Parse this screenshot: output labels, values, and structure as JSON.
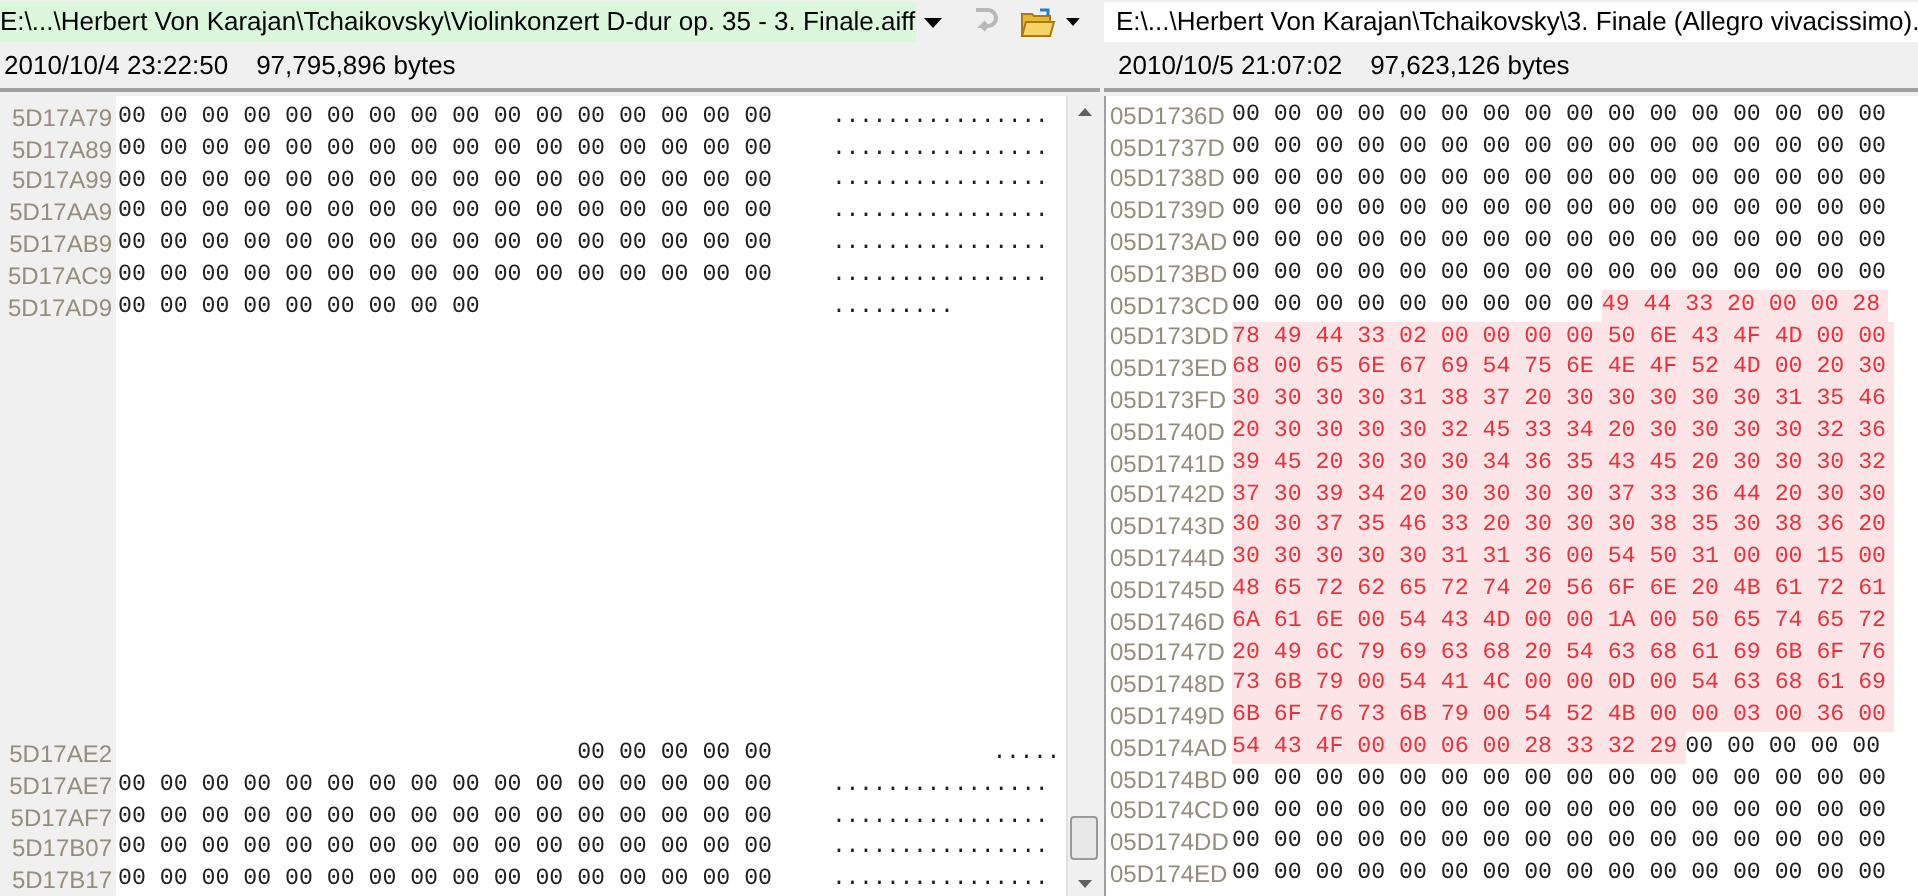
{
  "left": {
    "path": "E:\\...\\Herbert Von Karajan\\Tchaikovsky\\Violinkonzert D-dur op. 35 - 3. Finale.aiff",
    "modified": "2010/10/4 23:22:50",
    "size": "97,795,896 bytes",
    "blocks": [
      {
        "rows": [
          {
            "address": "5D17A79",
            "kind": "full",
            "segments": [
              {
                "text": "00 00 00 00 00 00 00 00 00 00 00 00 00 00 00 00",
                "changed": false
              }
            ],
            "ascii": "................"
          },
          {
            "address": "5D17A89",
            "kind": "full",
            "segments": [
              {
                "text": "00 00 00 00 00 00 00 00 00 00 00 00 00 00 00 00",
                "changed": false
              }
            ],
            "ascii": "................"
          },
          {
            "address": "5D17A99",
            "kind": "full",
            "segments": [
              {
                "text": "00 00 00 00 00 00 00 00 00 00 00 00 00 00 00 00",
                "changed": false
              }
            ],
            "ascii": "................"
          },
          {
            "address": "5D17AA9",
            "kind": "full",
            "segments": [
              {
                "text": "00 00 00 00 00 00 00 00 00 00 00 00 00 00 00 00",
                "changed": false
              }
            ],
            "ascii": "................"
          },
          {
            "address": "5D17AB9",
            "kind": "full",
            "segments": [
              {
                "text": "00 00 00 00 00 00 00 00 00 00 00 00 00 00 00 00",
                "changed": false
              }
            ],
            "ascii": "................"
          },
          {
            "address": "5D17AC9",
            "kind": "full",
            "segments": [
              {
                "text": "00 00 00 00 00 00 00 00 00 00 00 00 00 00 00 00",
                "changed": false
              }
            ],
            "ascii": "................"
          },
          {
            "address": "5D17AD9",
            "kind": "full",
            "segments": [
              {
                "text": "00 00 00 00 00 00 00 00 00",
                "changed": false
              }
            ],
            "ascii": "........."
          }
        ]
      },
      {
        "rows": [
          {
            "address": "5D17AE2",
            "kind": "tail",
            "segments": [
              {
                "text": "00 00 00 00 00",
                "changed": false
              }
            ],
            "ascii": "....."
          },
          {
            "address": "5D17AE7",
            "kind": "full",
            "segments": [
              {
                "text": "00 00 00 00 00 00 00 00 00 00 00 00 00 00 00 00",
                "changed": false
              }
            ],
            "ascii": "................"
          },
          {
            "address": "5D17AF7",
            "kind": "full",
            "segments": [
              {
                "text": "00 00 00 00 00 00 00 00 00 00 00 00 00 00 00 00",
                "changed": false
              }
            ],
            "ascii": "................"
          },
          {
            "address": "5D17B07",
            "kind": "full",
            "segments": [
              {
                "text": "00 00 00 00 00 00 00 00 00 00 00 00 00 00 00 00",
                "changed": false
              }
            ],
            "ascii": "................"
          },
          {
            "address": "5D17B17",
            "kind": "full",
            "segments": [
              {
                "text": "00 00 00 00 00 00 00 00 00 00 00 00 00 00 00 00",
                "changed": false
              }
            ],
            "ascii": "................"
          }
        ]
      }
    ]
  },
  "right": {
    "path": "E:\\...\\Herbert Von Karajan\\Tchaikovsky\\3. Finale (Allegro vivacissimo).",
    "modified": "2010/10/5 21:07:02",
    "size": "97,623,126 bytes",
    "rows": [
      {
        "address": "05D1736D",
        "segments": [
          {
            "text": "00 00 00 00 00 00 00 00 00 00 00 00 00 00 00 00",
            "changed": false
          }
        ]
      },
      {
        "address": "05D1737D",
        "segments": [
          {
            "text": "00 00 00 00 00 00 00 00 00 00 00 00 00 00 00 00",
            "changed": false
          }
        ]
      },
      {
        "address": "05D1738D",
        "segments": [
          {
            "text": "00 00 00 00 00 00 00 00 00 00 00 00 00 00 00 00",
            "changed": false
          }
        ]
      },
      {
        "address": "05D1739D",
        "segments": [
          {
            "text": "00 00 00 00 00 00 00 00 00 00 00 00 00 00 00 00",
            "changed": false
          }
        ]
      },
      {
        "address": "05D173AD",
        "segments": [
          {
            "text": "00 00 00 00 00 00 00 00 00 00 00 00 00 00 00 00",
            "changed": false
          }
        ]
      },
      {
        "address": "05D173BD",
        "segments": [
          {
            "text": "00 00 00 00 00 00 00 00 00 00 00 00 00 00 00 00",
            "changed": false
          }
        ]
      },
      {
        "address": "05D173CD",
        "segments": [
          {
            "text": "00 00 00 00 00 00 00 00 00",
            "changed": false
          },
          {
            "text": "49 44 33 20 00 00 28",
            "changed": true
          }
        ]
      },
      {
        "address": "05D173DD",
        "segments": [
          {
            "text": "78 49 44 33 02 00 00 00 00 50 6E 43 4F 4D 00 00",
            "changed": true
          }
        ]
      },
      {
        "address": "05D173ED",
        "segments": [
          {
            "text": "68 00 65 6E 67 69 54 75 6E 4E 4F 52 4D 00 20 30",
            "changed": true
          }
        ]
      },
      {
        "address": "05D173FD",
        "segments": [
          {
            "text": "30 30 30 30 31 38 37 20 30 30 30 30 30 31 35 46",
            "changed": true
          }
        ]
      },
      {
        "address": "05D1740D",
        "segments": [
          {
            "text": "20 30 30 30 30 32 45 33 34 20 30 30 30 30 32 36",
            "changed": true
          }
        ]
      },
      {
        "address": "05D1741D",
        "segments": [
          {
            "text": "39 45 20 30 30 30 34 36 35 43 45 20 30 30 30 32",
            "changed": true
          }
        ]
      },
      {
        "address": "05D1742D",
        "segments": [
          {
            "text": "37 30 39 34 20 30 30 30 30 37 33 36 44 20 30 30",
            "changed": true
          }
        ]
      },
      {
        "address": "05D1743D",
        "segments": [
          {
            "text": "30 30 37 35 46 33 20 30 30 30 38 35 30 38 36 20",
            "changed": true
          }
        ]
      },
      {
        "address": "05D1744D",
        "segments": [
          {
            "text": "30 30 30 30 30 31 31 36 00 54 50 31 00 00 15 00",
            "changed": true
          }
        ]
      },
      {
        "address": "05D1745D",
        "segments": [
          {
            "text": "48 65 72 62 65 72 74 20 56 6F 6E 20 4B 61 72 61",
            "changed": true
          }
        ]
      },
      {
        "address": "05D1746D",
        "segments": [
          {
            "text": "6A 61 6E 00 54 43 4D 00 00 1A 00 50 65 74 65 72",
            "changed": true
          }
        ]
      },
      {
        "address": "05D1747D",
        "segments": [
          {
            "text": "20 49 6C 79 69 63 68 20 54 63 68 61 69 6B 6F 76",
            "changed": true
          }
        ]
      },
      {
        "address": "05D1748D",
        "segments": [
          {
            "text": "73 6B 79 00 54 41 4C 00 00 0D 00 54 63 68 61 69",
            "changed": true
          }
        ]
      },
      {
        "address": "05D1749D",
        "segments": [
          {
            "text": "6B 6F 76 73 6B 79 00 54 52 4B 00 00 03 00 36 00",
            "changed": true
          }
        ]
      },
      {
        "address": "05D174AD",
        "segments": [
          {
            "text": "54 43 4F 00 00 06 00 28 33 32 29",
            "changed": true
          },
          {
            "text": "00 00 00 00 00",
            "changed": false
          }
        ]
      },
      {
        "address": "05D174BD",
        "segments": [
          {
            "text": "00 00 00 00 00 00 00 00 00 00 00 00 00 00 00 00",
            "changed": false
          }
        ]
      },
      {
        "address": "05D174CD",
        "segments": [
          {
            "text": "00 00 00 00 00 00 00 00 00 00 00 00 00 00 00 00",
            "changed": false
          }
        ]
      },
      {
        "address": "05D174DD",
        "segments": [
          {
            "text": "00 00 00 00 00 00 00 00 00 00 00 00 00 00 00 00",
            "changed": false
          }
        ]
      },
      {
        "address": "05D174ED",
        "segments": [
          {
            "text": "00 00 00 00 00 00 00 00 00 00 00 00 00 00 00 00",
            "changed": false
          }
        ]
      }
    ]
  }
}
